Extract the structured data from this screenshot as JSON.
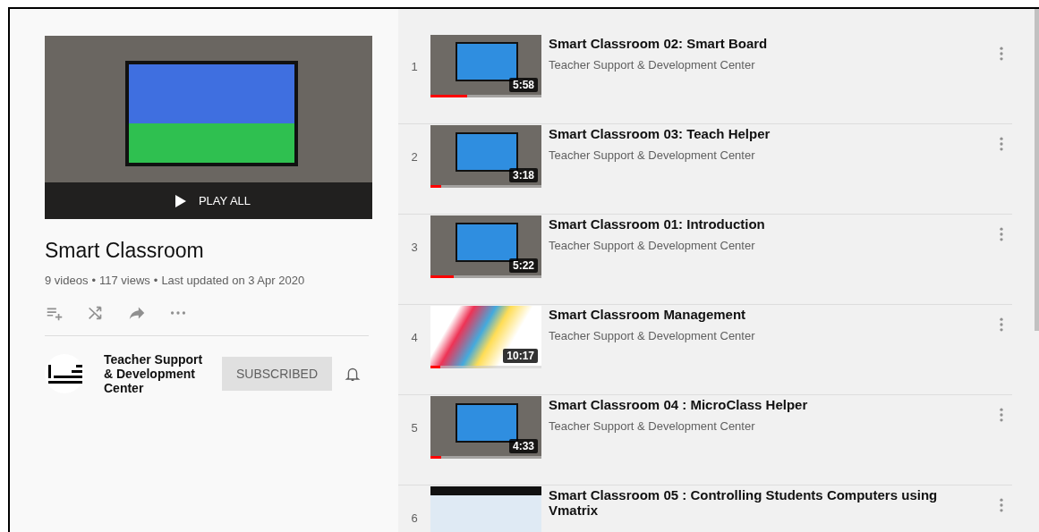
{
  "playlist": {
    "play_all": "PLAY ALL",
    "title": "Smart Classroom",
    "stats": [
      "9 videos",
      "117 views",
      "Last updated on 3 Apr 2020"
    ],
    "stats_separator": "•",
    "channel": {
      "name": "Teacher Support & Development Center",
      "subscribe_button": "SUBSCRIBED",
      "subscribed": true
    }
  },
  "videos": [
    {
      "index": "1",
      "title": "Smart Classroom 02: Smart Board",
      "channel": "Teacher Support & Development Center",
      "duration": "5:58",
      "level": 0.33,
      "kind": "classroom"
    },
    {
      "index": "2",
      "title": "Smart Classroom 03: Teach Helper",
      "channel": "Teacher Support & Development Center",
      "duration": "3:18",
      "level": 0.1,
      "kind": "classroom"
    },
    {
      "index": "3",
      "title": "Smart Classroom 01: Introduction",
      "channel": "Teacher Support & Development Center",
      "duration": "5:22",
      "level": 0.21,
      "kind": "classroom"
    },
    {
      "index": "4",
      "title": "Smart Classroom Management",
      "channel": "Teacher Support & Development Center",
      "duration": "10:17",
      "level": 0.09,
      "kind": "slide"
    },
    {
      "index": "5",
      "title": "Smart Classroom 04 : MicroClass Helper",
      "channel": "Teacher Support & Development Center",
      "duration": "4:33",
      "level": 0.1,
      "kind": "classroom"
    },
    {
      "index": "6",
      "title": "Smart Classroom 05 : Controlling Students Computers using Vmatrix",
      "kind": "screen"
    }
  ]
}
